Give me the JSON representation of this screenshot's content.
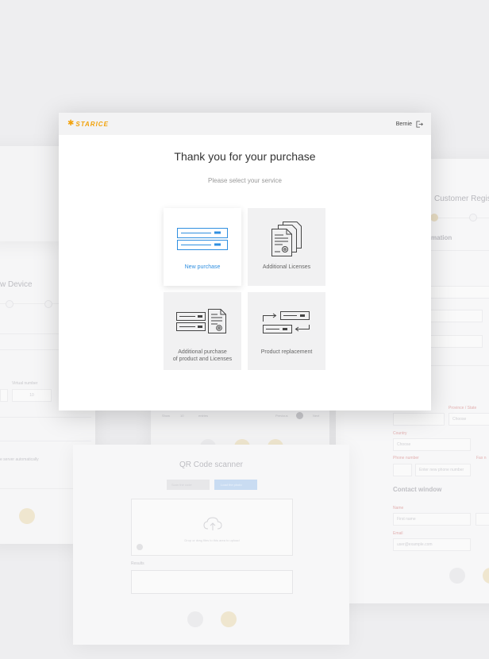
{
  "modal": {
    "brand": "STARICE",
    "user_name": "Bernie",
    "title": "Thank you for your purchase",
    "subtitle": "Please select your service",
    "tiles": [
      {
        "label": "New purchase",
        "active": true
      },
      {
        "label": "Additional Licenses",
        "active": false
      },
      {
        "label": "Additional purchase of product and Licenses",
        "label_line1": "Additional purchase",
        "label_line2": "of product and Licenses",
        "active": false
      },
      {
        "label": "Product replacement",
        "active": false
      }
    ]
  },
  "background": {
    "new_device": {
      "title": "w Device",
      "virtual_number_label": "Virtual number",
      "virtual_number_value": "10",
      "auto_text": "e server automatically"
    },
    "customer_reg": {
      "title": "Customer Regis",
      "section": "mation",
      "province_label": "Province / State",
      "country_label": "Country",
      "phone_label": "Phone number",
      "fax_label": "Fax n",
      "contact_title": "Contact window",
      "name_label": "Name",
      "email_label": "Email",
      "name_placeholder": "First name",
      "email_placeholder": "user@example.com",
      "phone_placeholder": "Enter new phone number",
      "country_placeholder": "Choose",
      "province_placeholder": "Choose"
    },
    "qr": {
      "title": "QR Code scanner",
      "btn_scan": "Scan the code",
      "btn_load": "Load the photo",
      "drop_text": "Drop or drag files to this area to upload",
      "results_label": "Results"
    },
    "table": {
      "show_label": "Show",
      "show_value": "10",
      "entries_label": "entries",
      "previous": "Previous",
      "page": "1",
      "next": "Next"
    }
  },
  "colors": {
    "brand": "#f2a20b",
    "accent_blue": "#2f8fe0",
    "tile_bg": "#f1f1f2"
  }
}
